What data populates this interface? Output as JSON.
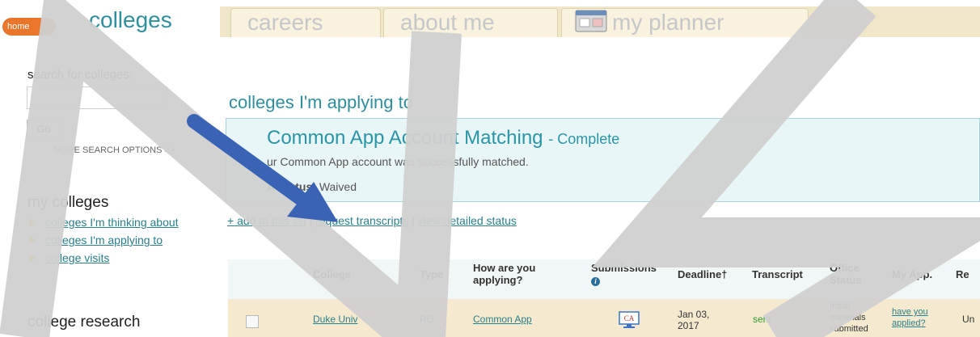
{
  "nav": {
    "home": "home",
    "active_tab": "colleges",
    "tabs": [
      "careers",
      "about me",
      "my planner"
    ]
  },
  "sidebar": {
    "search_heading": "search for colleges:",
    "search_placeholder": "",
    "go": "Go",
    "more_options": "MORE SEARCH OPTIONS >>",
    "my_colleges_heading": "my colleges",
    "items": [
      {
        "label": "colleges I'm thinking about"
      },
      {
        "label": "colleges I'm applying to"
      },
      {
        "label": "college visits"
      }
    ],
    "research_heading": "college research"
  },
  "main": {
    "title": "colleges I'm applying to",
    "notice": {
      "title": "Common App Account Matching",
      "status": "- Complete",
      "message": "ur Common App account was successfully matched.",
      "ferpa_label": "A Status:",
      "ferpa_value": "Waived"
    },
    "links": {
      "add": "+ add to this list",
      "sep1": "|",
      "request": "request transcripts",
      "sep2": "|",
      "detailed": "view detailed status"
    },
    "table": {
      "headers": {
        "college": "College",
        "type": "Type",
        "how": "How are you applying?",
        "submissions": "Submissions",
        "deadline": "Deadline†",
        "transcript": "Transcript",
        "office": "Office Status",
        "myapp": "My App.",
        "re": "Re"
      },
      "row": {
        "college": "Duke Univ",
        "type": "RD",
        "how": "Common App",
        "submission_icon": "CA",
        "deadline": "Jan 03, 2017",
        "transcript": "sent",
        "office": "Initial materials submitted",
        "myapp": "have you applied?",
        "re": "Un"
      }
    }
  },
  "colors": {
    "accent": "#2f8f9d",
    "home": "#e9762b",
    "sent": "#2e9a2e",
    "arrow": "#3b63b5"
  },
  "watermark": "NS"
}
